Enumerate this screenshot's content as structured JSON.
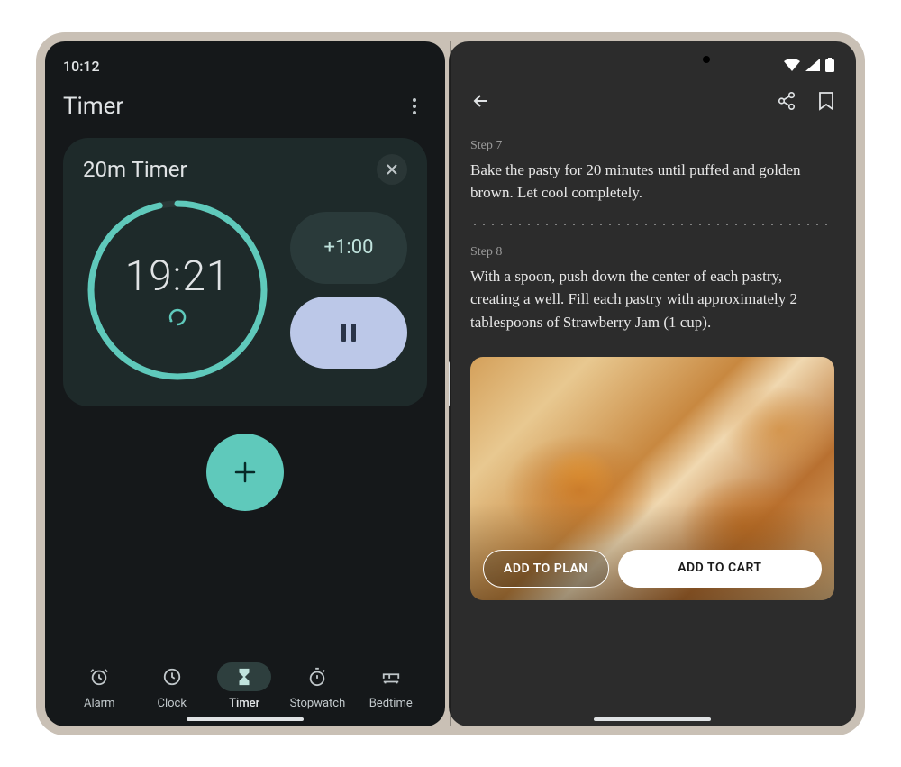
{
  "left": {
    "status_time": "10:12",
    "title": "Timer",
    "card": {
      "name": "20m Timer",
      "time": "19:21",
      "progress_fraction": 0.967
    },
    "buttons": {
      "add_time": "+1:00"
    },
    "nav": [
      {
        "id": "alarm",
        "label": "Alarm"
      },
      {
        "id": "clock",
        "label": "Clock"
      },
      {
        "id": "timer",
        "label": "Timer"
      },
      {
        "id": "stopwatch",
        "label": "Stopwatch"
      },
      {
        "id": "bedtime",
        "label": "Bedtime"
      }
    ]
  },
  "right": {
    "steps": [
      {
        "label": "Step 7",
        "text": "Bake the pasty for 20 minutes until puffed and golden brown. Let cool completely."
      },
      {
        "label": "Step 8",
        "text": "With a spoon, push down the center of each pastry, creating a well. Fill each pastry with approximately 2 tablespoons of Strawberry Jam (1 cup)."
      }
    ],
    "buttons": {
      "add_to_plan": "ADD TO PLAN",
      "add_to_cart": "ADD TO CART"
    }
  }
}
